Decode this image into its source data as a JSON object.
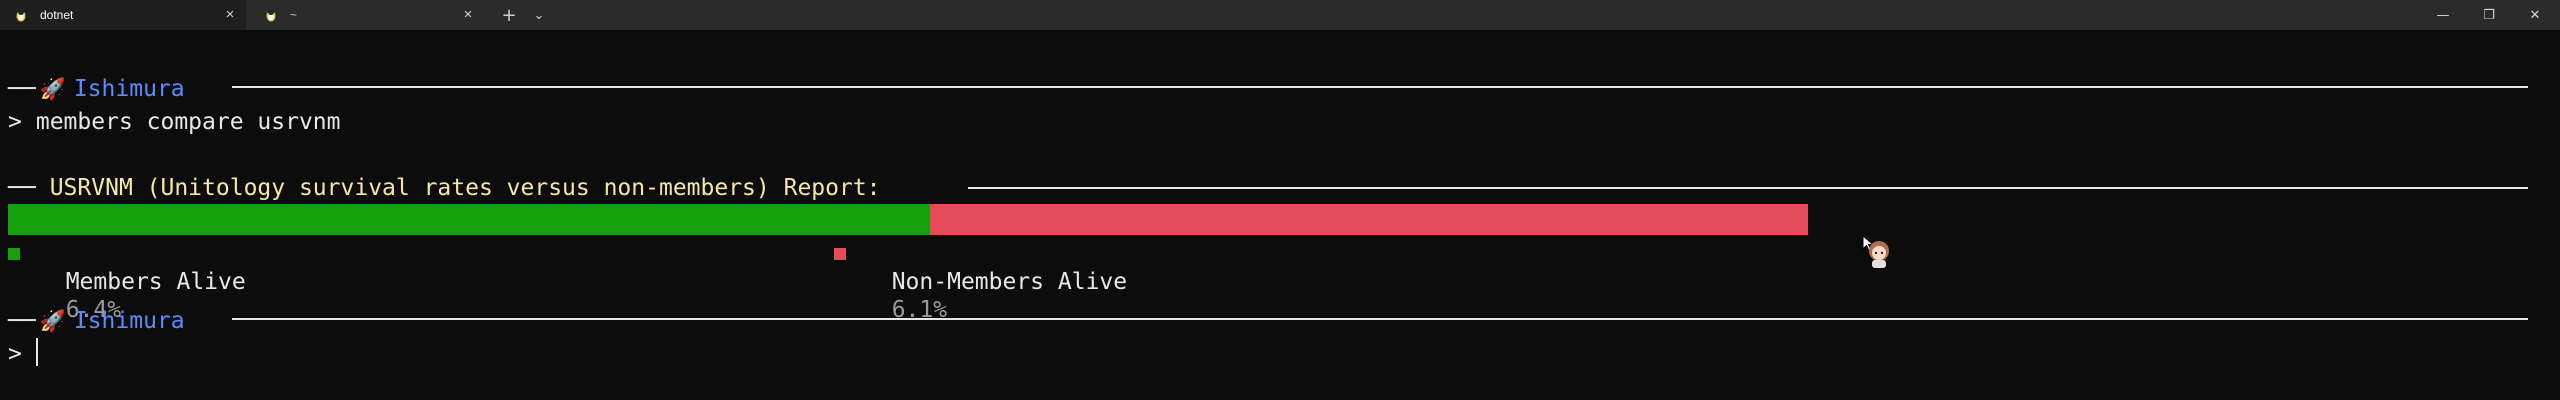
{
  "tabs": [
    {
      "title": "dotnet",
      "active": true
    },
    {
      "title": "~",
      "active": false
    }
  ],
  "tab_actions": {
    "new_tab": "+",
    "dropdown": "⌄"
  },
  "window_controls": {
    "minimize": "—",
    "restore": "❐",
    "close": "✕"
  },
  "terminal": {
    "banner1": {
      "prefix": "──",
      "icon": "🚀",
      "name": "Ishimura"
    },
    "command_prompt": ">",
    "command": "members compare usrvnm",
    "report": {
      "prefix": "──",
      "title": "USRVNM (Unitology survival rates versus non-members) Report:"
    },
    "banner2": {
      "prefix": "──",
      "icon": "🚀",
      "name": "Ishimura"
    },
    "input_prompt": ">"
  },
  "chart_data": {
    "type": "bar",
    "orientation": "horizontal-stacked",
    "series": [
      {
        "name": "Members Alive",
        "label": "6.4%",
        "value": 6.4,
        "color": "#16a00e"
      },
      {
        "name": "Non-Members Alive",
        "label": "6.1%",
        "value": 6.1,
        "color": "#e54b5a"
      }
    ]
  },
  "colors": {
    "background": "#0c0c0c",
    "accent": "#5b8cff",
    "title": "#f5e8a0"
  }
}
